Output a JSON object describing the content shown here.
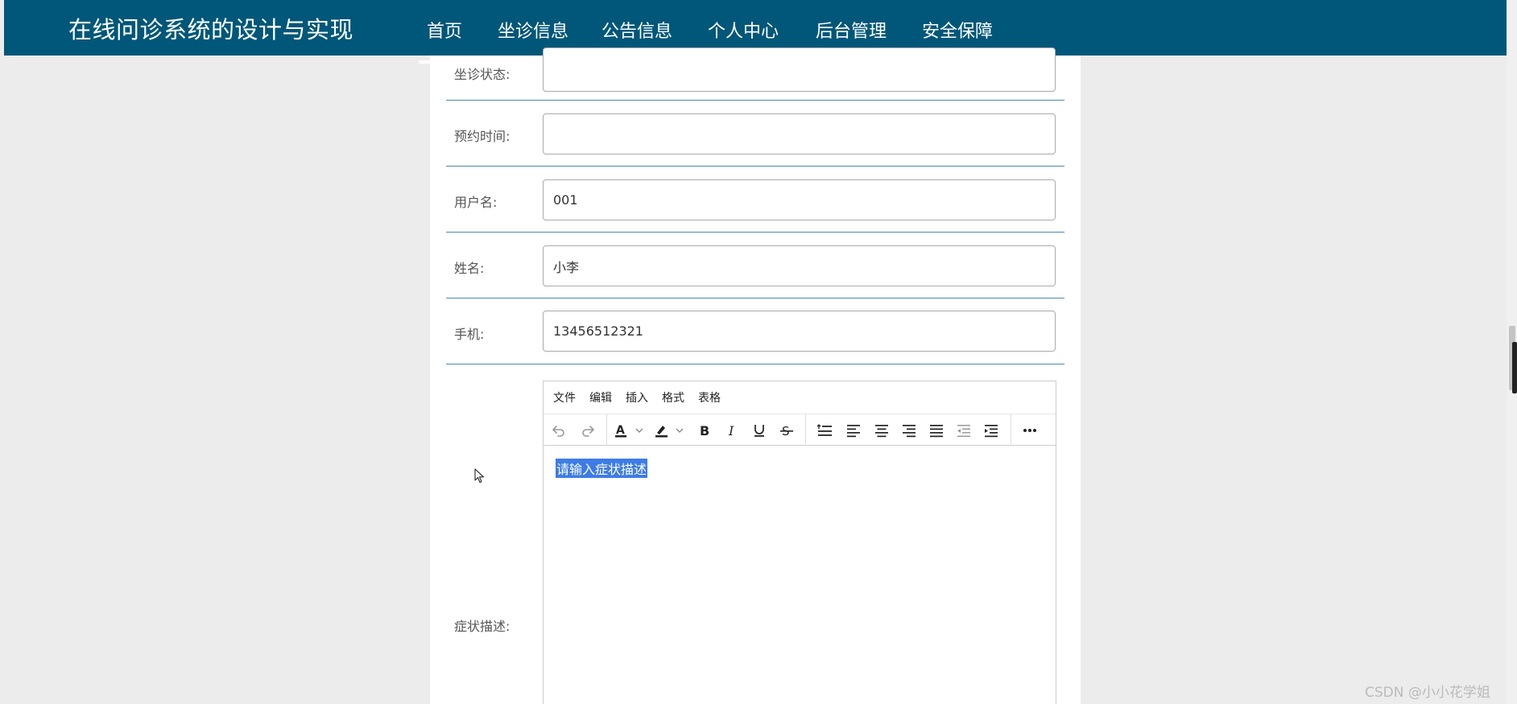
{
  "header": {
    "brand": "在线问诊系统的设计与实现",
    "nav": [
      {
        "label": "首页",
        "active": true
      },
      {
        "label": "坐诊信息"
      },
      {
        "label": "公告信息"
      },
      {
        "label": "个人中心"
      },
      {
        "label": "后台管理"
      },
      {
        "label": "安全保障"
      }
    ]
  },
  "form": {
    "fields": [
      {
        "label": "坐诊状态:",
        "value": ""
      },
      {
        "label": "预约时间:",
        "value": ""
      },
      {
        "label": "用户名:",
        "value": "001"
      },
      {
        "label": "姓名:",
        "value": "小李"
      },
      {
        "label": "手机:",
        "value": "13456512321"
      }
    ],
    "symptom_label": "症状描述:"
  },
  "editor": {
    "menus": [
      "文件",
      "编辑",
      "插入",
      "格式",
      "表格"
    ],
    "toolbar_icons": [
      "undo-icon",
      "redo-icon",
      "text-color-icon",
      "highlight-color-icon",
      "bold-icon",
      "italic-icon",
      "underline-icon",
      "strikethrough-icon",
      "line-height-icon",
      "align-left-icon",
      "align-center-icon",
      "align-right-icon",
      "align-justify-icon",
      "outdent-icon",
      "indent-icon",
      "more-icon"
    ],
    "placeholder": "请输入症状描述"
  },
  "watermark": "CSDN @小小花学姐",
  "colors": {
    "navbar": "#015779",
    "row_divider": "#4a8ab6",
    "selection": "#3d7ce6"
  }
}
